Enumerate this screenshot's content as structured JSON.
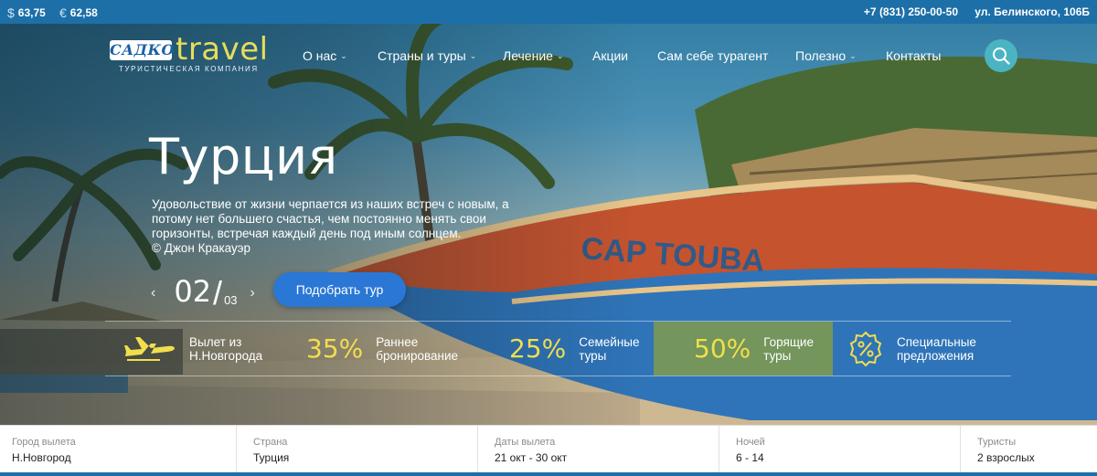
{
  "topbar": {
    "usd_symbol": "$",
    "usd_rate": "63,75",
    "eur_symbol": "€",
    "eur_rate": "62,58",
    "phone": "+7 (831) 250-00-50",
    "address": "ул. Белинского, 106Б"
  },
  "logo": {
    "brand": "САДКО",
    "travel": "travel",
    "tagline": "ТУРИСТИЧЕСКАЯ КОМПАНИЯ"
  },
  "nav": {
    "items": [
      {
        "label": "О нас",
        "has_dropdown": true
      },
      {
        "label": "Страны и туры",
        "has_dropdown": true
      },
      {
        "label": "Лечение",
        "has_dropdown": true
      },
      {
        "label": "Акции",
        "has_dropdown": false
      },
      {
        "label": "Сам себе турагент",
        "has_dropdown": false
      },
      {
        "label": "Полезно",
        "has_dropdown": true
      },
      {
        "label": "Контакты",
        "has_dropdown": false
      }
    ],
    "search_icon": "search-icon"
  },
  "hero": {
    "title": "Турция",
    "quote": "Удовольствие от жизни черпается из наших встреч с новым, а потому нет большего счастья, чем постоянно менять свои горизонты, встречая каждый день под иным солнцем.",
    "author": "© Джон Кракауэр",
    "slide_current": "02",
    "slide_total": "03",
    "cta_label": "Подобрать тур",
    "boat_text": "CAP TOUBA"
  },
  "features": [
    {
      "icon": "airplane-icon",
      "pct": "",
      "text1": "Вылет из",
      "text2": "Н.Новгорода"
    },
    {
      "icon": "",
      "pct": "35%",
      "text1": "Раннее",
      "text2": "бронирование"
    },
    {
      "icon": "",
      "pct": "25%",
      "text1": "Семейные",
      "text2": "туры"
    },
    {
      "icon": "",
      "pct": "50%",
      "text1": "Горящие",
      "text2": "туры"
    },
    {
      "icon": "percent-badge-icon",
      "pct": "",
      "text1": "Специальные",
      "text2": "предложения"
    }
  ],
  "search_form": {
    "fields": [
      {
        "label": "Город вылета",
        "value": "Н.Новгород"
      },
      {
        "label": "Страна",
        "value": "Турция"
      },
      {
        "label": "Даты вылета",
        "value": "21 окт - 30 окт"
      },
      {
        "label": "Ночей",
        "value": "6 - 14"
      },
      {
        "label": "Туристы",
        "value": "2 взрослых"
      }
    ]
  },
  "colors": {
    "topbar": "#1d6fa8",
    "accent_yellow": "#f2de4d",
    "cta_blue": "#2a77d6",
    "search_teal": "#4bb4c2",
    "hot_highlight": "#8ca03c"
  }
}
